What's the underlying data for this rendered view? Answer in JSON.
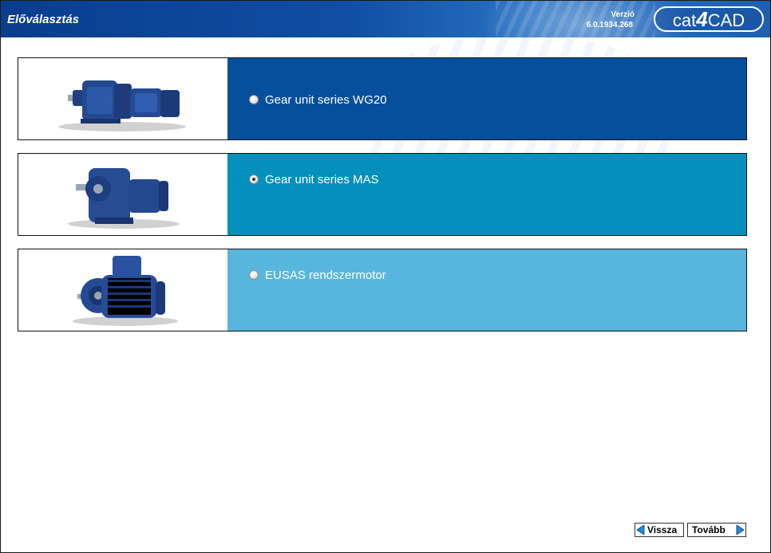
{
  "header": {
    "title": "Előválasztás",
    "version_label": "Verzió",
    "version_value": "6.0.1934.268",
    "logo": "cat4CAD"
  },
  "colors": {
    "header_blue": "#0f4ea3",
    "option1_panel": "#064f9d",
    "option2_panel": "#0390bd",
    "option3_panel": "#58b6de"
  },
  "options": [
    {
      "label": "Gear unit series WG20",
      "selected": false,
      "image_icon": "gear-unit-wg20-image"
    },
    {
      "label": "Gear unit series MAS",
      "selected": true,
      "image_icon": "gear-unit-mas-image"
    },
    {
      "label": "EUSAS rendszermotor",
      "selected": false,
      "image_icon": "eusas-motor-image"
    }
  ],
  "nav": {
    "back_label": "Vissza",
    "next_label": "Tovább"
  }
}
